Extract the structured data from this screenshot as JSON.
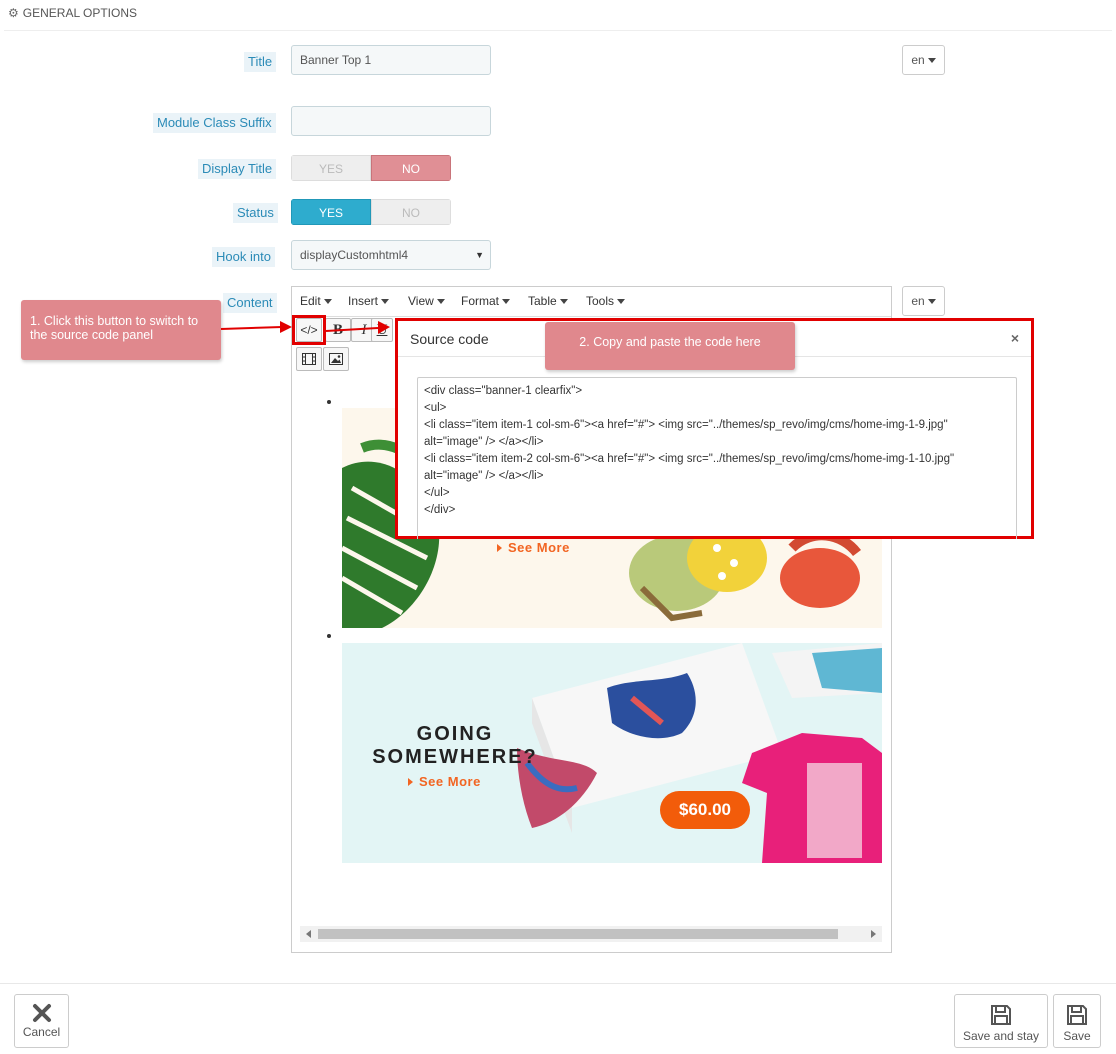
{
  "section": {
    "title": "GENERAL OPTIONS",
    "icon": "gears-icon"
  },
  "form": {
    "title_label": "Title",
    "title_value": "Banner Top 1",
    "lang": "en",
    "suffix_label": "Module Class Suffix",
    "suffix_value": "",
    "display_title_label": "Display Title",
    "display_title": {
      "yes": "YES",
      "no": "NO",
      "selected": "NO"
    },
    "status_label": "Status",
    "status": {
      "yes": "YES",
      "no": "NO",
      "selected": "YES"
    },
    "hook_label": "Hook into",
    "hook_value": "displayCustomhtml4",
    "content_label": "Content",
    "content_lang": "en"
  },
  "editor": {
    "menu": [
      "Edit",
      "Insert",
      "View",
      "Format",
      "Table",
      "Tools"
    ],
    "toolbar": {
      "source_code": "</>",
      "bold": "B",
      "italic": "I",
      "underline": "U"
    },
    "banner1": {
      "cta": "See More"
    },
    "banner2": {
      "heading_line1": "GOING",
      "heading_line2": "SOMEWHERE?",
      "cta": "See More",
      "price": "$60.00"
    }
  },
  "dialog": {
    "title": "Source code",
    "close": "×",
    "code": "<div class=\"banner-1 clearfix\">\n<ul>\n<li class=\"item item-1 col-sm-6\"><a href=\"#\"> <img src=\"../themes/sp_revo/img/cms/home-img-1-9.jpg\"\nalt=\"image\" /> </a></li>\n<li class=\"item item-2 col-sm-6\"><a href=\"#\"> <img src=\"../themes/sp_revo/img/cms/home-img-1-10.jpg\"\nalt=\"image\" /> </a></li>\n</ul>\n</div>"
  },
  "callouts": {
    "step1": "1. Click this button to switch to the source code panel",
    "step2": "2. Copy and paste the code here"
  },
  "footer": {
    "cancel": "Cancel",
    "save_and_stay": "Save and stay",
    "save": "Save"
  },
  "colors": {
    "accent": "#2eacce",
    "danger": "#e10000",
    "callout": "#e0888d",
    "no_active": "#e08f95",
    "price": "#f25c0a"
  }
}
